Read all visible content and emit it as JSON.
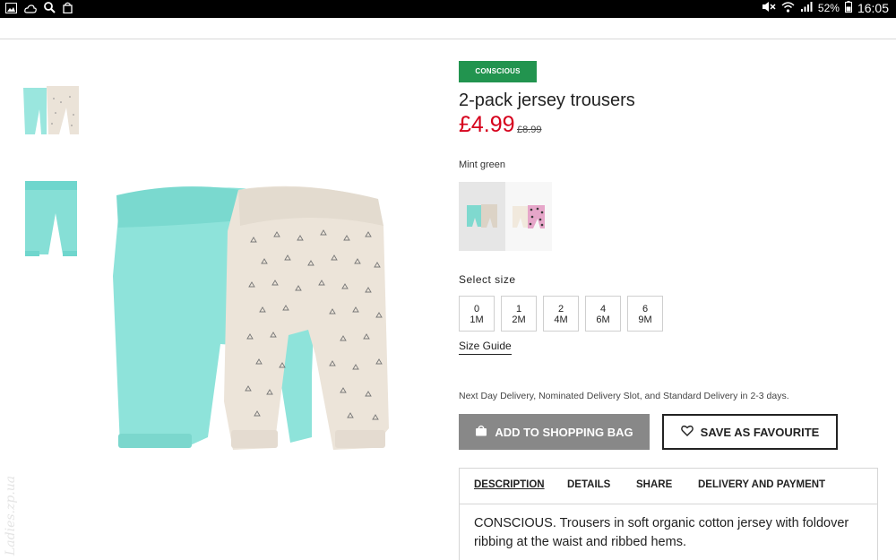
{
  "status_bar": {
    "battery": "52%",
    "time": "16:05",
    "left_icons": [
      "gallery-icon",
      "cloud-icon",
      "search-icon",
      "shopping-bag-icon"
    ],
    "right_icons": [
      "mute-icon",
      "wifi-icon",
      "signal-icon",
      "battery-icon"
    ]
  },
  "product": {
    "badge": "CONSCIOUS",
    "title": "2-pack jersey trousers",
    "price": "£4.99",
    "old_price": "£8.99",
    "colour_name": "Mint green",
    "select_size_label": "Select size",
    "sizes": [
      {
        "top": "0",
        "bottom": "1M"
      },
      {
        "top": "1",
        "bottom": "2M"
      },
      {
        "top": "2",
        "bottom": "4M"
      },
      {
        "top": "4",
        "bottom": "6M"
      },
      {
        "top": "6",
        "bottom": "9M"
      }
    ],
    "size_guide": "Size Guide",
    "delivery_info": "Next Day Delivery, Nominated Delivery Slot, and Standard Delivery in 2-3 days."
  },
  "actions": {
    "add_to_bag": "ADD TO SHOPPING BAG",
    "save_favourite": "SAVE AS FAVOURITE"
  },
  "tabs": [
    {
      "label": "DESCRIPTION"
    },
    {
      "label": "DETAILS"
    },
    {
      "label": "SHARE"
    },
    {
      "label": "DELIVERY AND PAYMENT"
    }
  ],
  "description": "CONSCIOUS. Trousers in soft organic cotton jersey with foldover ribbing at the waist and ribbed hems.",
  "watermark": "Ladies.zp.ua",
  "colors": {
    "badge": "#22944f",
    "price": "#d6001c",
    "mint": "#7fe0d9",
    "beige": "#ece4da",
    "bag_button": "#888888"
  }
}
